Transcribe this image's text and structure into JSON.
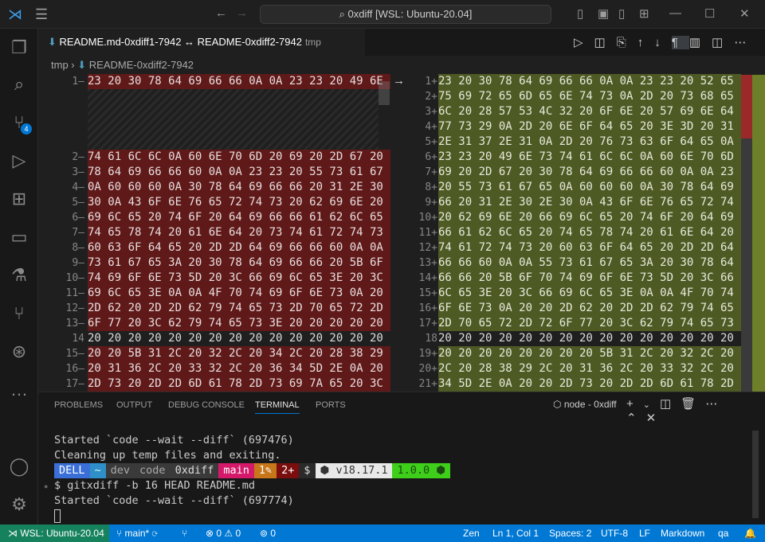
{
  "title_search": "0xdiff [WSL: Ubuntu-20.04]",
  "tab": {
    "label": "README.md-0xdiff1-7942 ↔ README-0xdiff2-7942",
    "desc": "tmp"
  },
  "breadcrumb": {
    "folder": "tmp",
    "file": "README-0xdiff2-7942"
  },
  "scm_badge": "4",
  "left": [
    {
      "n": "1",
      "m": "—",
      "hex": "23 20 30 78 64 69 66 66 0A 0A 23 23 20 49 6E"
    },
    {
      "n": "2",
      "m": "—",
      "hex": "74 61 6C 6C 0A 60 6E 70 6D 20 69 20 2D 67 20"
    },
    {
      "n": "3",
      "m": "—",
      "hex": "78 64 69 66 66 60 0A 0A 23 23 20 55 73 61 67"
    },
    {
      "n": "4",
      "m": "—",
      "hex": "0A 60 60 60 0A 30 78 64 69 66 66 20 31 2E 30"
    },
    {
      "n": "5",
      "m": "—",
      "hex": "30 0A 43 6F 6E 76 65 72 74 73 20 62 69 6E 20"
    },
    {
      "n": "6",
      "m": "—",
      "hex": "69 6C 65 20 74 6F 20 64 69 66 66 61 62 6C 65"
    },
    {
      "n": "7",
      "m": "—",
      "hex": "74 65 78 74 20 61 6E 64 20 73 74 61 72 74 73"
    },
    {
      "n": "8",
      "m": "—",
      "hex": "60 63 6F 64 65 20 2D 2D 64 69 66 66 60 0A 0A"
    },
    {
      "n": "9",
      "m": "—",
      "hex": "73 61 67 65 3A 20 30 78 64 69 66 66 20 5B 6F"
    },
    {
      "n": "10",
      "m": "—",
      "hex": "74 69 6F 6E 73 5D 20 3C 66 69 6C 65 3E 20 3C"
    },
    {
      "n": "11",
      "m": "—",
      "hex": "69 6C 65 3E 0A 0A 4F 70 74 69 6F 6E 73 0A 20"
    },
    {
      "n": "12",
      "m": "—",
      "hex": "2D 62 20 2D 2D 62 79 74 65 73 2D 70 65 72 2D"
    },
    {
      "n": "13",
      "m": "—",
      "hex": "6F 77 20 3C 62 79 74 65 73 3E 20 20 20 20 20"
    },
    {
      "n": "14",
      "m": "",
      "hex": "20 20 20 20 20 20 20 20 20 20 20 20 20 20 20",
      "same": true
    },
    {
      "n": "15",
      "m": "—",
      "hex": "20 20 5B 31 2C 20 32 2C 20 34 2C 20 28 38 29"
    },
    {
      "n": "16",
      "m": "—",
      "hex": "20 31 36 2C 20 33 32 2C 20 36 34 5D 2E 0A 20"
    },
    {
      "n": "17",
      "m": "—",
      "hex": "2D 73 20 2D 2D 6D 61 78 2D 73 69 7A 65 20 3C"
    }
  ],
  "right": [
    {
      "n": "1",
      "m": "+",
      "hex": "23 20 30 78 64 69 66 66 0A 0A 23 23 20 52 65"
    },
    {
      "n": "2",
      "m": "+",
      "hex": "75 69 72 65 6D 65 6E 74 73 0A 2D 20 73 68 65"
    },
    {
      "n": "3",
      "m": "+",
      "hex": "6C 20 28 57 53 4C 32 20 6F 6E 20 57 69 6E 64"
    },
    {
      "n": "4",
      "m": "+",
      "hex": "77 73 29 0A 2D 20 6E 6F 64 65 20 3E 3D 20 31"
    },
    {
      "n": "5",
      "m": "+",
      "hex": "2E 31 37 2E 31 0A 2D 20 76 73 63 6F 64 65 0A"
    },
    {
      "n": "6",
      "m": "+",
      "hex": "23 23 20 49 6E 73 74 61 6C 6C 0A 60 6E 70 6D"
    },
    {
      "n": "7",
      "m": "+",
      "hex": "69 20 2D 67 20 30 78 64 69 66 66 60 0A 0A 23"
    },
    {
      "n": "8",
      "m": "+",
      "hex": "20 55 73 61 67 65 0A 60 60 60 0A 30 78 64 69"
    },
    {
      "n": "9",
      "m": "+",
      "hex": "66 20 31 2E 30 2E 30 0A 43 6F 6E 76 65 72 74"
    },
    {
      "n": "10",
      "m": "+",
      "hex": "20 62 69 6E 20 66 69 6C 65 20 74 6F 20 64 69"
    },
    {
      "n": "11",
      "m": "+",
      "hex": "66 61 62 6C 65 20 74 65 78 74 20 61 6E 64 20"
    },
    {
      "n": "12",
      "m": "+",
      "hex": "74 61 72 74 73 20 60 63 6F 64 65 20 2D 2D 64"
    },
    {
      "n": "13",
      "m": "+",
      "hex": "66 66 60 0A 0A 55 73 61 67 65 3A 20 30 78 64"
    },
    {
      "n": "14",
      "m": "+",
      "hex": "66 66 20 5B 6F 70 74 69 6F 6E 73 5D 20 3C 66"
    },
    {
      "n": "15",
      "m": "+",
      "hex": "6C 65 3E 20 3C 66 69 6C 65 3E 0A 0A 4F 70 74"
    },
    {
      "n": "16",
      "m": "+",
      "hex": "6F 6E 73 0A 20 20 2D 62 20 2D 2D 62 79 74 65"
    },
    {
      "n": "17",
      "m": "+",
      "hex": "2D 70 65 72 2D 72 6F 77 20 3C 62 79 74 65 73"
    },
    {
      "n": "18",
      "m": "",
      "hex": "20 20 20 20 20 20 20 20 20 20 20 20 20 20 20",
      "same": true
    },
    {
      "n": "19",
      "m": "+",
      "hex": "20 20 20 20 20 20 20 20 5B 31 2C 20 32 2C 20"
    },
    {
      "n": "20",
      "m": "+",
      "hex": "2C 20 28 38 29 2C 20 31 36 2C 20 33 32 2C 20"
    },
    {
      "n": "21",
      "m": "+",
      "hex": "34 5D 2E 0A 20 20 2D 73 20 2D 2D 6D 61 78 2D"
    }
  ],
  "panel": {
    "tabs": [
      "PROBLEMS",
      "OUTPUT",
      "DEBUG CONSOLE",
      "TERMINAL",
      "PORTS"
    ],
    "terminal_name": "node - 0xdiff"
  },
  "terminal": {
    "line1": "Started `code --wait --diff` (697476)",
    "line2": "Cleaning up temp files and exiting.",
    "prompt": [
      {
        "t": "DELL",
        "bg": "#3a6fd8",
        "fg": "#fff"
      },
      {
        "t": "~",
        "bg": "#2f8fc9",
        "fg": "#cfe"
      },
      {
        "t": "dev",
        "bg": "#3a3a3a",
        "fg": "#aaa"
      },
      {
        "t": "code",
        "bg": "#3a3a3a",
        "fg": "#aaa"
      },
      {
        "t": "0xdiff",
        "bg": "#3a3a3a",
        "fg": "#ddd"
      },
      {
        "t": "main",
        "bg": "#d4196a",
        "fg": "#fff"
      },
      {
        "t": "1✎",
        "bg": "#c7761a",
        "fg": "#fff"
      },
      {
        "t": "2+",
        "bg": "#7a0d0d",
        "fg": "#fff"
      },
      {
        "t": "$",
        "bg": "#2a2a2a",
        "fg": "#ddd"
      },
      {
        "t": "⬢ v18.17.1",
        "bg": "#e8e8e8",
        "fg": "#333"
      },
      {
        "t": "1.0.0 ⬢",
        "bg": "#3ecf1a",
        "fg": "#1a4a10"
      }
    ],
    "line3": "$ gitxdiff -b 16 HEAD README.md",
    "line4": "Started `code --wait --diff` (697774)"
  },
  "status": {
    "remote": "WSL: Ubuntu-20.04",
    "branch": "main*",
    "errors": "0",
    "warnings": "0",
    "ports": "0",
    "zen": "Zen",
    "pos": "Ln 1, Col 1",
    "spaces": "Spaces: 2",
    "enc": "UTF-8",
    "eol": "LF",
    "lang": "Markdown",
    "user": "qa"
  }
}
